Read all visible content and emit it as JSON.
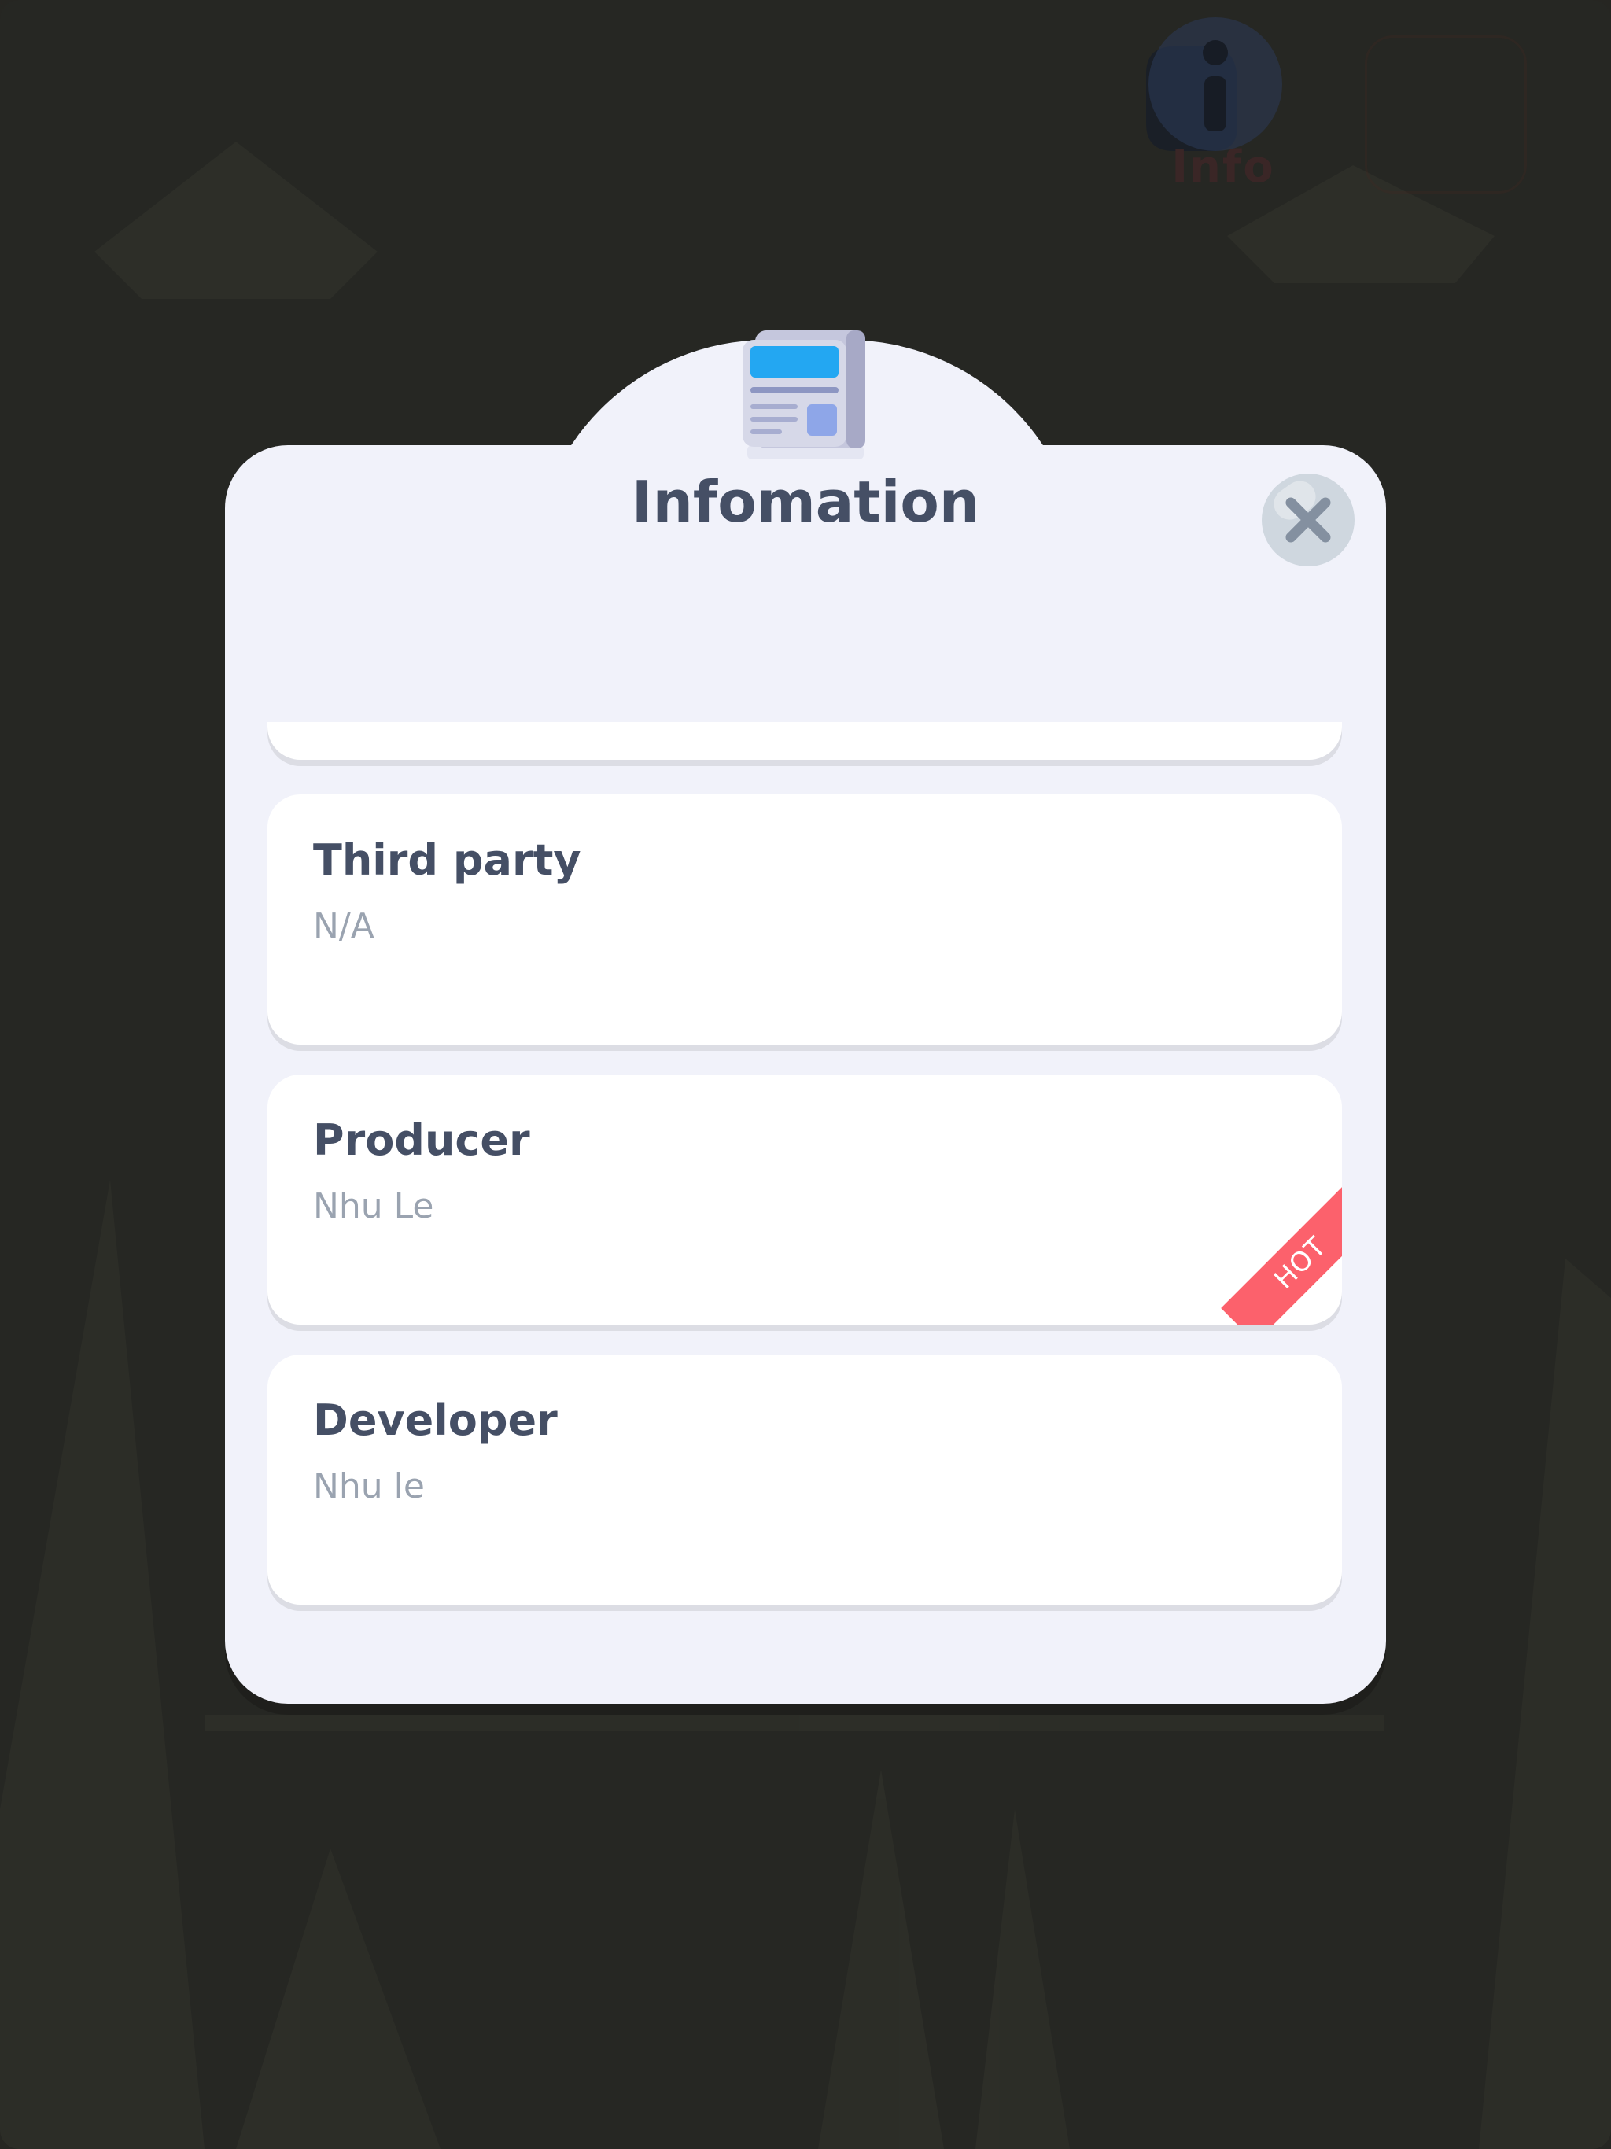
{
  "background": {
    "info_button_label": "Info",
    "info_icon": "info-icon",
    "home_icon": "home-icon"
  },
  "modal": {
    "title": "Infomation",
    "header_icon": "newspaper-icon",
    "close_icon": "close-icon",
    "items": [
      {
        "title": "Third party",
        "value": "N/A"
      },
      {
        "title": "Producer",
        "value": "Nhu Le",
        "badge": "HOT"
      },
      {
        "title": "Developer",
        "value": "Nhu le"
      }
    ]
  },
  "colors": {
    "panel": "#f1f2fa",
    "card": "#ffffff",
    "title_text": "#454f65",
    "value_text": "#9aa3b0",
    "hot_ribbon": "#fc616c",
    "close_button": "#cfd7df",
    "overlay": "#262723"
  }
}
